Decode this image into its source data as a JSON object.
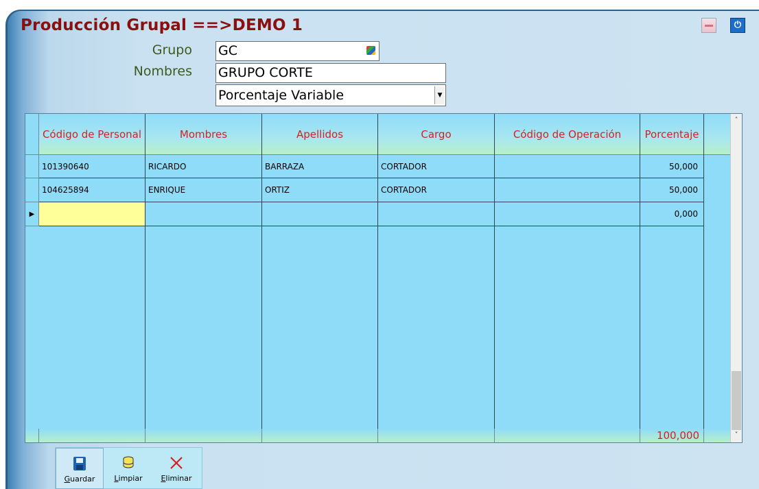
{
  "window": {
    "title": "Producción Grupal ==>DEMO 1"
  },
  "form": {
    "grupo_label": "Grupo",
    "grupo_value": "GC",
    "nombres_label": "Nombres",
    "nombres_value": "GRUPO CORTE",
    "tipo_value": "Porcentaje Variable"
  },
  "grid": {
    "columns": [
      "Código de Personal",
      "Mombres",
      "Apellidos",
      "Cargo",
      "Código de Operación",
      "Porcentaje"
    ],
    "rows": [
      {
        "codigo": "101390640",
        "nombres": "RICARDO",
        "apellidos": "BARRAZA",
        "cargo": "CORTADOR",
        "operacion": "",
        "porcentaje": "50,000"
      },
      {
        "codigo": "104625894",
        "nombres": "ENRIQUE",
        "apellidos": "ORTIZ",
        "cargo": "CORTADOR",
        "operacion": "",
        "porcentaje": "50,000"
      },
      {
        "codigo": "",
        "nombres": "",
        "apellidos": "",
        "cargo": "",
        "operacion": "",
        "porcentaje": "0,000"
      }
    ],
    "total": "100,000",
    "row_indicator": "▶"
  },
  "toolbar": {
    "guardar_label": "uardar",
    "guardar_key": "G",
    "limpiar_label": "impiar",
    "limpiar_key": "L",
    "eliminar_label": "liminar",
    "eliminar_key": "E"
  },
  "colors": {
    "title": "#8b0f0f",
    "header_text": "#d81f1f",
    "grid_bg": "#8fdcf9",
    "new_row_cell": "#ffff99"
  }
}
